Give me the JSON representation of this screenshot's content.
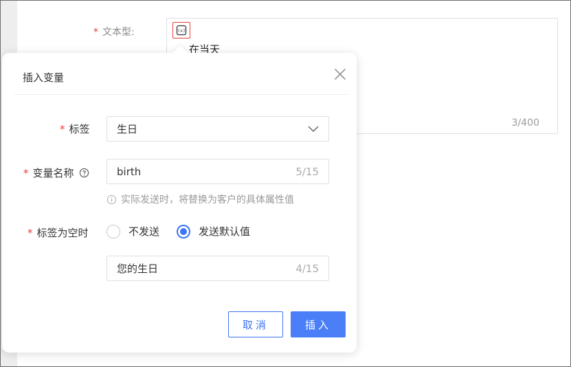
{
  "background_form": {
    "label": "文本型:",
    "required_mark": "*",
    "text": "在当天",
    "char_count": "3/400"
  },
  "dialog": {
    "title": "插入变量",
    "tag": {
      "required_mark": "*",
      "label": "标签",
      "value": "生日"
    },
    "var_name": {
      "required_mark": "*",
      "label": "变量名称",
      "value": "birth",
      "count": "5/15",
      "hint": "实际发送时，将替换为客户的具体属性值"
    },
    "empty_tag": {
      "required_mark": "*",
      "label": "标签为空时",
      "options": [
        {
          "label": "不发送",
          "selected": false
        },
        {
          "label": "发送默认值",
          "selected": true
        }
      ],
      "default_value": "您的生日",
      "default_count": "4/15"
    },
    "cancel_label": "取消",
    "insert_label": "插入"
  },
  "colors": {
    "primary": "#3d73f5",
    "required": "#e8403a"
  }
}
